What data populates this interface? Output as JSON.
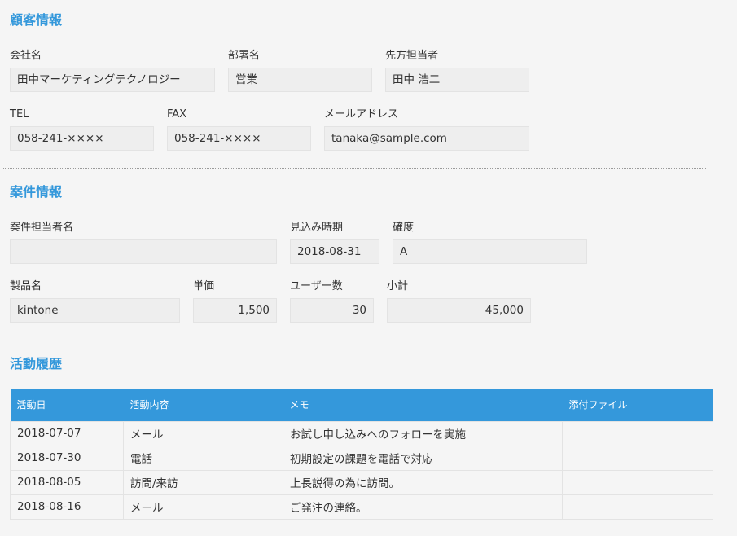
{
  "customer_section": {
    "title": "顧客情報",
    "fields": {
      "company": {
        "label": "会社名",
        "value": "田中マーケティングテクノロジー"
      },
      "department": {
        "label": "部署名",
        "value": "営業"
      },
      "contact": {
        "label": "先方担当者",
        "value": "田中 浩二"
      },
      "tel": {
        "label": "TEL",
        "value": "058-241-××××"
      },
      "fax": {
        "label": "FAX",
        "value": "058-241-××××"
      },
      "email": {
        "label": "メールアドレス",
        "value": "tanaka@sample.com"
      }
    }
  },
  "deal_section": {
    "title": "案件情報",
    "fields": {
      "owner": {
        "label": "案件担当者名",
        "value": ""
      },
      "expected_date": {
        "label": "見込み時期",
        "value": "2018-08-31"
      },
      "certainty": {
        "label": "確度",
        "value": "A"
      },
      "product": {
        "label": "製品名",
        "value": "kintone"
      },
      "unit_price": {
        "label": "単価",
        "value": "1,500"
      },
      "users": {
        "label": "ユーザー数",
        "value": "30"
      },
      "subtotal": {
        "label": "小計",
        "value": "45,000"
      }
    }
  },
  "activity_section": {
    "title": "活動履歴",
    "columns": [
      "活動日",
      "活動内容",
      "メモ",
      "添付ファイル"
    ],
    "rows": [
      {
        "date": "2018-07-07",
        "activity": "メール",
        "memo": "お試し申し込みへのフォローを実施",
        "attachment": ""
      },
      {
        "date": "2018-07-30",
        "activity": "電話",
        "memo": "初期設定の課題を電話で対応",
        "attachment": ""
      },
      {
        "date": "2018-08-05",
        "activity": "訪問/来訪",
        "memo": "上長説得の為に訪問。",
        "attachment": ""
      },
      {
        "date": "2018-08-16",
        "activity": "メール",
        "memo": "ご発注の連絡。",
        "attachment": ""
      }
    ]
  },
  "colors": {
    "accent": "#3498db",
    "field_bg": "#eeeeee",
    "page_bg": "#f5f5f5"
  }
}
